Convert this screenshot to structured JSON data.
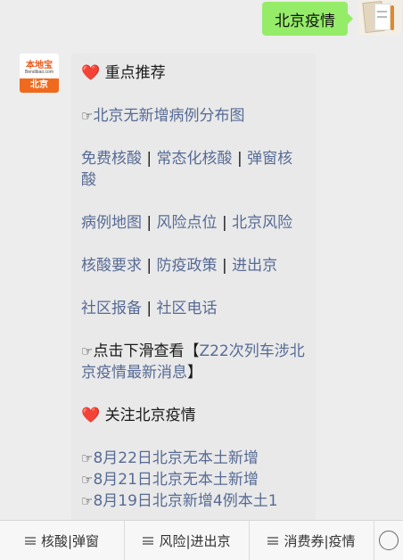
{
  "sent": {
    "text": "北京疫情"
  },
  "account": {
    "logo_text": "本地宝",
    "logo_url": "Bendibao.com",
    "city": "北京"
  },
  "message": {
    "heading1": {
      "icon": "❤️",
      "label": "重点推荐"
    },
    "line1": {
      "icon": "☞",
      "text": "北京无新增病例分布图"
    },
    "row_a": [
      "免费核酸",
      "常态化核酸",
      "弹窗核酸"
    ],
    "row_b": [
      "病例地图",
      "风险点位",
      "北京风险"
    ],
    "row_c": [
      "核酸要求",
      "防疫政策",
      "进出京"
    ],
    "row_d": [
      "社区报备",
      "社区电话"
    ],
    "promo": {
      "icon": "☞",
      "prefix": "点击下滑查看【",
      "link": "Z22次列车涉北京疫情最新消息",
      "suffix": "】"
    },
    "heading2": {
      "icon": "❤️",
      "label": "关注北京疫情"
    },
    "news": [
      {
        "icon": "☞",
        "text": "8月22日北京无本土新增"
      },
      {
        "icon": "☞",
        "text": "8月21日北京无本土新增"
      },
      {
        "icon": "☞",
        "text": "8月19日北京新增4例本土1"
      }
    ],
    "separator": " | "
  },
  "menu": {
    "items": [
      "核酸|弹窗",
      "风险|进出京",
      "消费券|疫情"
    ]
  }
}
